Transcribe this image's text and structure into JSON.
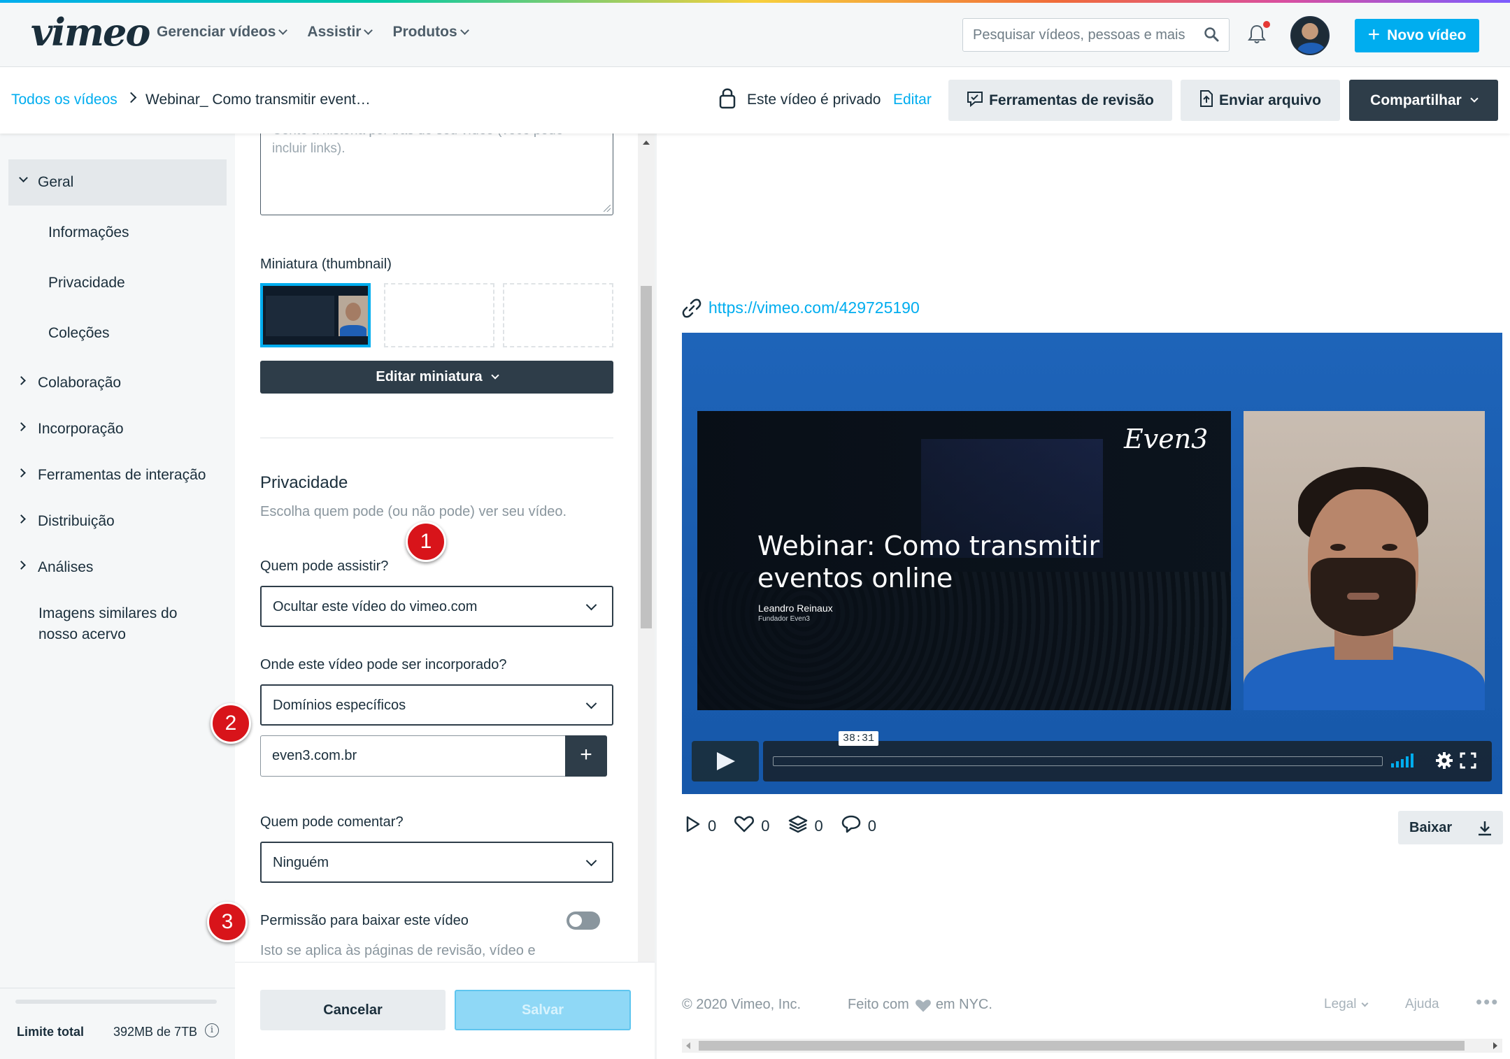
{
  "header": {
    "logo": "vimeo",
    "nav": [
      "Gerenciar vídeos",
      "Assistir",
      "Produtos"
    ],
    "search_placeholder": "Pesquisar vídeos, pessoas e mais",
    "new_video_label": "Novo vídeo",
    "notification_unread": true
  },
  "subheader": {
    "breadcrumb_root": "Todos os vídeos",
    "breadcrumb_current": "Webinar_ Como transmitir event…",
    "privacy_status": "Este vídeo é privado",
    "privacy_edit": "Editar",
    "review_tools_label": "Ferramentas de revisão",
    "upload_file_label": "Enviar arquivo",
    "share_label": "Compartilhar"
  },
  "sidebar": {
    "section_open": "Geral",
    "sub_items": [
      "Informações",
      "Privacidade",
      "Coleções"
    ],
    "sections": [
      "Colaboração",
      "Incorporação",
      "Ferramentas de interação",
      "Distribuição",
      "Análises"
    ],
    "extra_line1": "Imagens similares do",
    "extra_line2": "nosso acervo",
    "limit_label": "Limite total",
    "limit_value": "392MB de 7TB",
    "info_icon": "i"
  },
  "form": {
    "description_placeholder_line1": "Conte a história por trás do seu vídeo (você pode",
    "description_placeholder_line2": "incluir links).",
    "thumbnail_label": "Miniatura (thumbnail)",
    "edit_thumbnail_label": "Editar miniatura",
    "privacy_title": "Privacidade",
    "privacy_subtitle": "Escolha quem pode (ou não pode) ver seu vídeo.",
    "who_can_watch_label": "Quem pode assistir?",
    "who_can_watch_value": "Ocultar este vídeo do vimeo.com",
    "embed_label": "Onde este vídeo pode ser incorporado?",
    "embed_value": "Domínios específicos",
    "domain_value": "even3.com.br",
    "domain_add": "+",
    "comment_label": "Quem pode comentar?",
    "comment_value": "Ninguém",
    "download_permission_label": "Permissão para baixar este vídeo",
    "download_permission_enabled": false,
    "download_permission_note": "Isto se aplica às páginas de revisão, vídeo e",
    "cancel_label": "Cancelar",
    "save_label": "Salvar"
  },
  "markers": [
    "1",
    "2",
    "3"
  ],
  "video": {
    "url": "https://vimeo.com/429725190",
    "slide_logo": "Even3",
    "slide_title": "Webinar: Como transmitir eventos online",
    "slide_presenter": "Leandro Reinaux",
    "slide_role": "Fundador Even3",
    "time": "38:31",
    "stats": {
      "plays": "0",
      "likes": "0",
      "collections": "0",
      "comments": "0"
    },
    "download_label": "Baixar"
  },
  "footer": {
    "copyright": "© 2020 Vimeo, Inc.",
    "made_with_pre": "Feito com",
    "made_with_post": "em NYC.",
    "legal": "Legal",
    "help": "Ajuda",
    "more": "•••"
  },
  "colors": {
    "accent": "#00adef",
    "dark": "#2e3d49",
    "marker": "#d8141a"
  }
}
